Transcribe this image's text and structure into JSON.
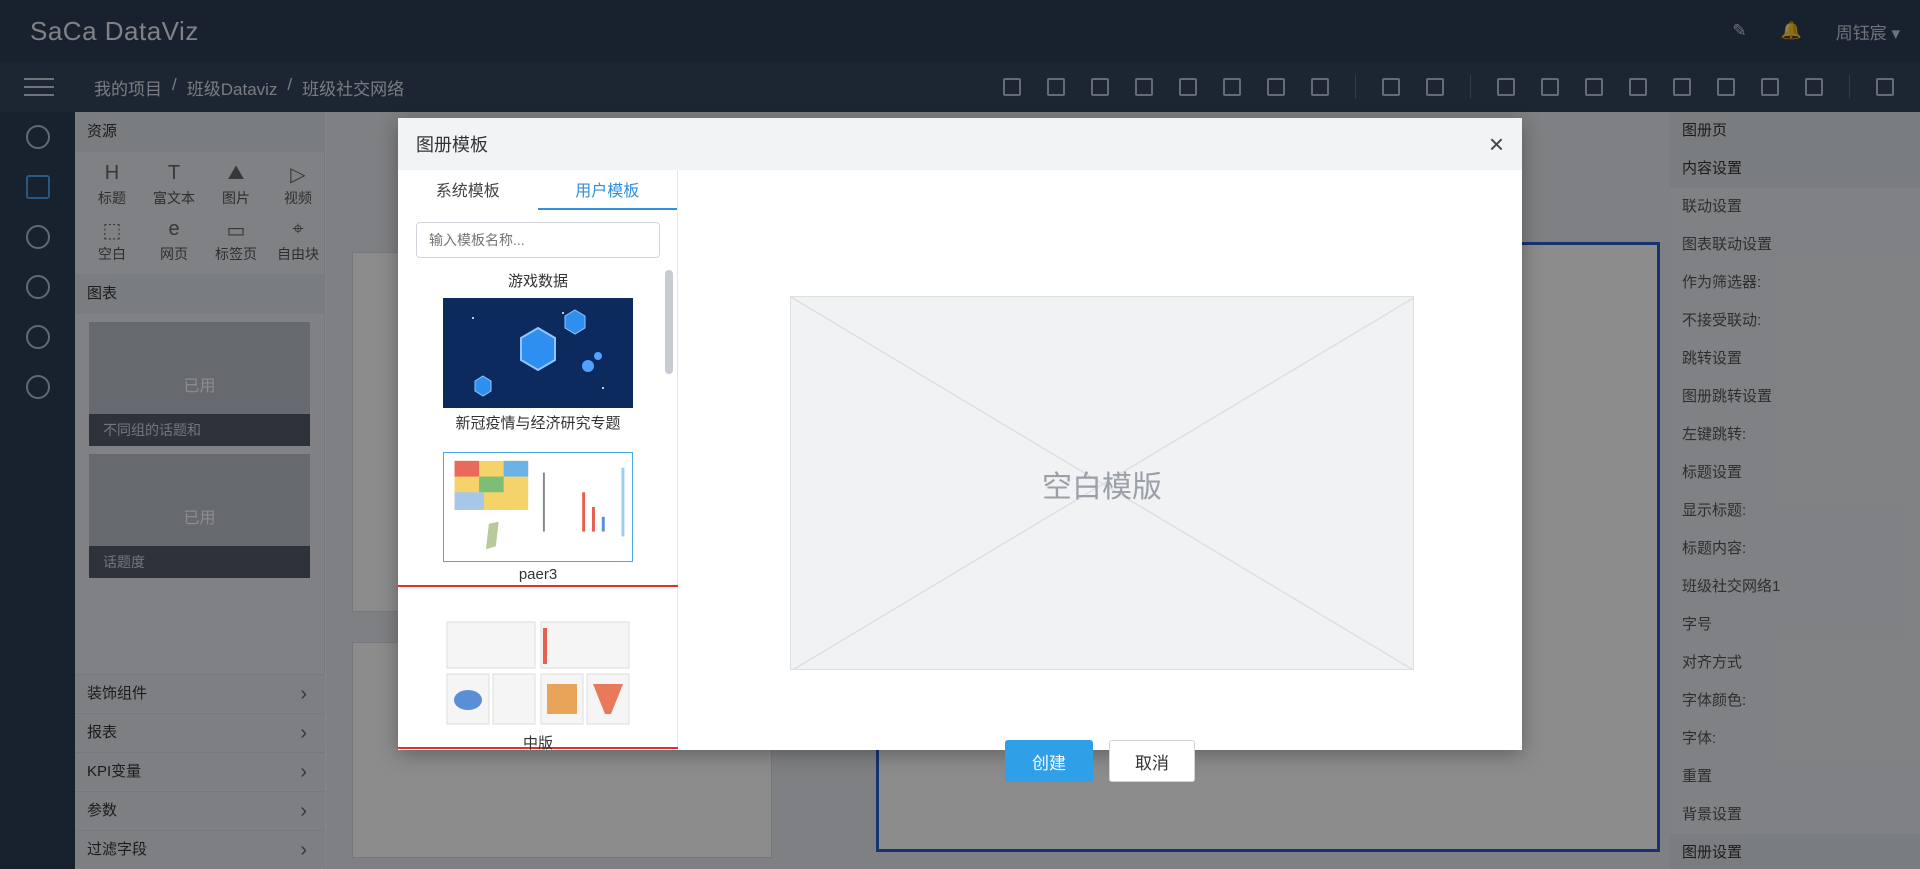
{
  "app": {
    "logo": "SaCa DataViz",
    "user": "周钰宸 ▾"
  },
  "breadcrumb": [
    "我的项目",
    "/",
    "班级Dataviz",
    "/",
    "班级社交网络"
  ],
  "resources": {
    "title": "资源",
    "items": [
      "标题",
      "富文本",
      "图片",
      "视频",
      "空白",
      "网页",
      "标签页",
      "自由块"
    ],
    "charts_title": "图表",
    "thumbs": [
      {
        "badge": "已用",
        "caption": "不同组的话题和"
      },
      {
        "badge": "已用",
        "caption": "话题度"
      }
    ],
    "accordions": [
      "装饰组件",
      "报表",
      "KPI变量",
      "参数",
      "过滤字段"
    ]
  },
  "rightpanel": {
    "title": "图册页",
    "content": "内容设置",
    "rows": [
      "联动设置",
      "图表联动设置",
      "作为筛选器:",
      "不接受联动:",
      "跳转设置",
      "图册跳转设置",
      "左键跳转:",
      "标题设置",
      "显示标题:",
      "标题内容:",
      "字号",
      "对齐方式",
      "字体颜色:",
      "字体:",
      "重置",
      "背景设置"
    ],
    "title_value": "班级社交网络1",
    "footer": "图册设置"
  },
  "modal": {
    "title": "图册模板",
    "tabs": [
      "系统模板",
      "用户模板"
    ],
    "active_tab": "用户模板",
    "search_placeholder": "输入模板名称...",
    "templates": [
      "游戏数据",
      "新冠疫情与经济研究专题",
      "paer3",
      "中版"
    ],
    "selected_template": "paer3",
    "preview_text": "空白模版",
    "create_label": "创建",
    "cancel_label": "取消",
    "close_label": "×"
  },
  "colors": {
    "accent": "#2f9fe8",
    "selection": "#e0302a",
    "topbar": "#2d3d55"
  }
}
